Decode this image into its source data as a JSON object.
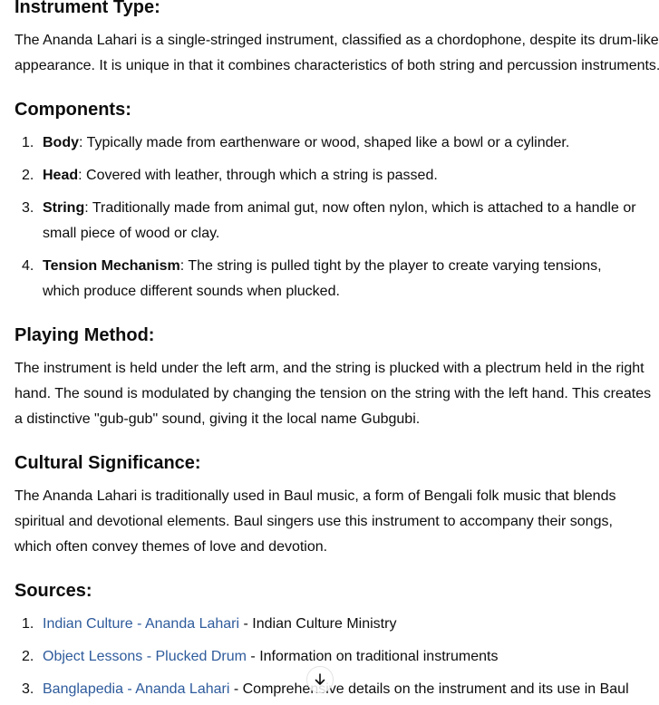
{
  "instrument_type": {
    "heading": "Instrument Type:",
    "text": "The Ananda Lahari is a single-stringed instrument, classified as a chordophone, despite its drum-like appearance. It is unique in that it combines characteristics of both string and percussion instruments."
  },
  "components": {
    "heading": "Components:",
    "items": [
      {
        "num": "1.",
        "term": "Body",
        "text": ": Typically made from earthenware or wood, shaped like a bowl or a cylinder."
      },
      {
        "num": "2.",
        "term": "Head",
        "text": ": Covered with leather, through which a string is passed."
      },
      {
        "num": "3.",
        "term": "String",
        "text": ": Traditionally made from animal gut, now often nylon, which is attached to a handle or small piece of wood or clay."
      },
      {
        "num": "4.",
        "term": "Tension Mechanism",
        "text": ": The string is pulled tight by the player to create varying tensions, which produce different sounds when plucked."
      }
    ]
  },
  "playing_method": {
    "heading": "Playing Method:",
    "text": "The instrument is held under the left arm, and the string is plucked with a plectrum held in the right hand. The sound is modulated by changing the tension on the string with the left hand. This creates a distinctive \"gub-gub\" sound, giving it the local name Gubgubi."
  },
  "cultural_significance": {
    "heading": "Cultural Significance:",
    "text": "The Ananda Lahari is traditionally used in Baul music, a form of Bengali folk music that blends spiritual and devotional elements. Baul singers use this instrument to accompany their songs, which often convey themes of love and devotion."
  },
  "sources": {
    "heading": "Sources:",
    "items": [
      {
        "num": "1.",
        "link": "Indian Culture - Ananda Lahari",
        "desc": " - Indian Culture Ministry"
      },
      {
        "num": "2.",
        "link": "Object Lessons - Plucked Drum",
        "desc": " - Information on traditional instruments"
      },
      {
        "num": "3.",
        "link": "Banglapedia - Ananda Lahari",
        "desc": " - Comprehensive details on the instrument and its use in Baul"
      }
    ]
  },
  "scroll_button": {
    "icon": "arrow-down-icon"
  }
}
